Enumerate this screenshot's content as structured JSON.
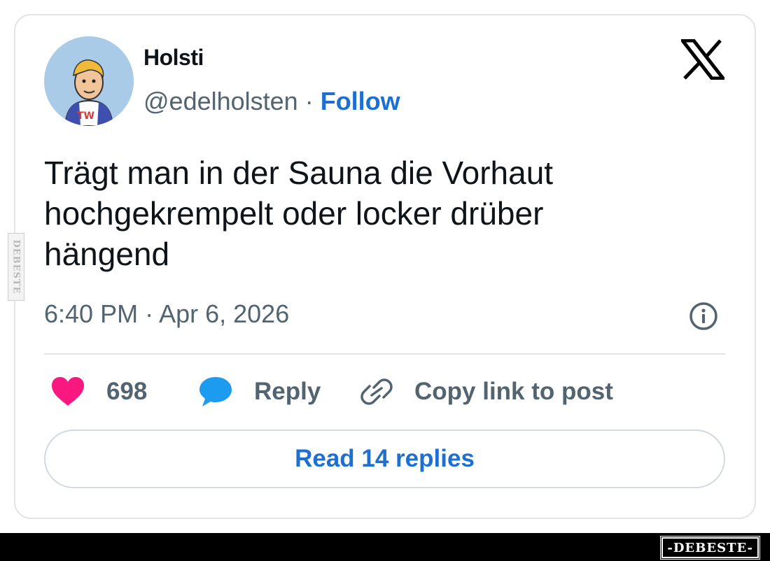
{
  "author": {
    "name": "Holsti",
    "handle": "@edelholsten",
    "separator": " · ",
    "follow_label": "Follow"
  },
  "tweet": {
    "lines": [
      "Trägt man in der Sauna die Vorhaut",
      "hochgekrempelt oder locker drüber",
      "hängend"
    ],
    "timestamp": "6:40 PM · Apr 6, 2026"
  },
  "actions": {
    "likes_count": "698",
    "reply_label": "Reply",
    "copy_label": "Copy link to post"
  },
  "read_replies_label": "Read 14 replies",
  "watermarks": {
    "side": "DEBESTE",
    "footer": "-DEBESTE-"
  },
  "icons": {
    "brand": "x-logo-icon",
    "info": "info-icon",
    "like": "heart-icon",
    "reply": "speech-bubble-icon",
    "copy": "link-icon"
  },
  "colors": {
    "accent_blue": "#1d6fd1",
    "like_pink": "#f91880",
    "reply_blue": "#1d9bf0",
    "muted_text": "#536471",
    "border": "#e1e5e9"
  }
}
